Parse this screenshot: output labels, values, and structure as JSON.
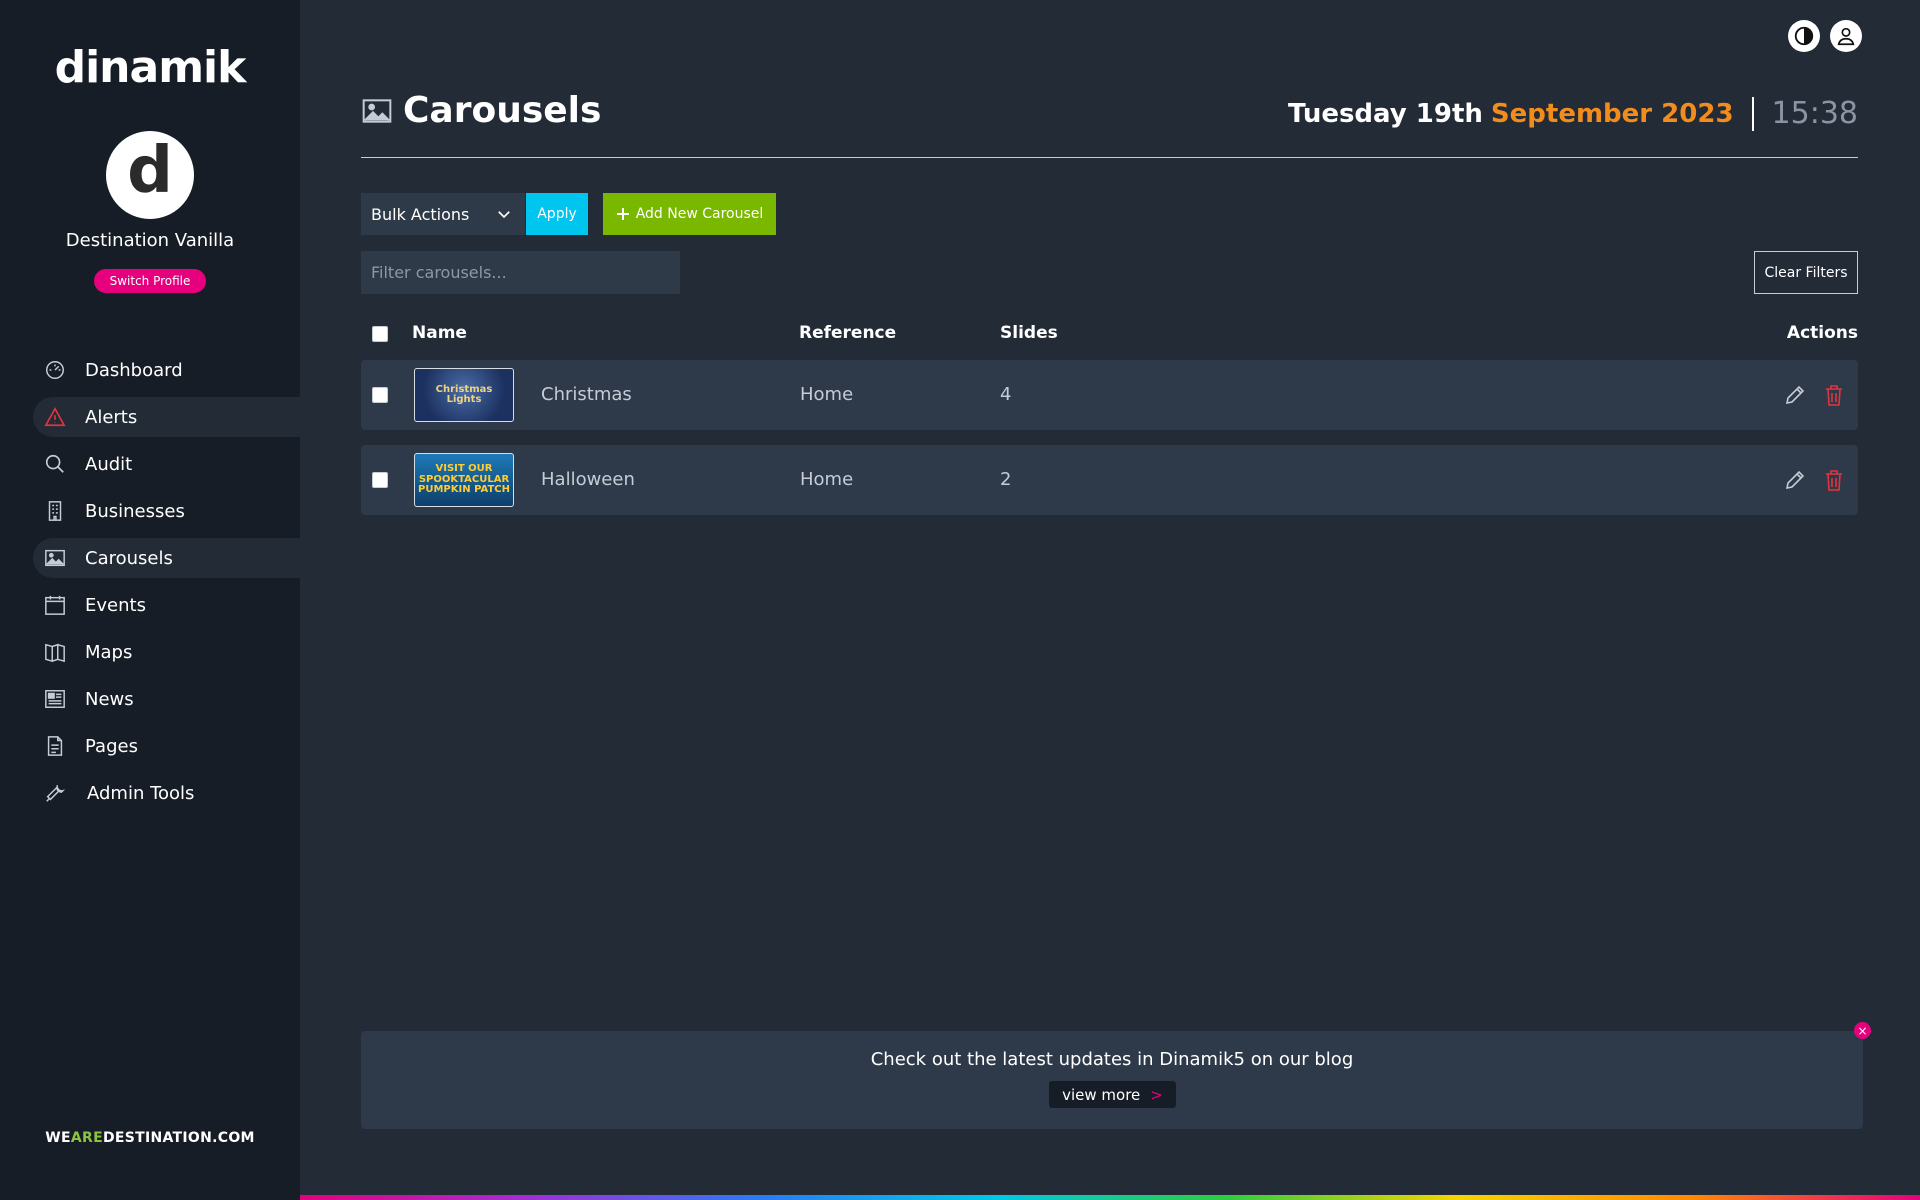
{
  "sidebar": {
    "logo": "dinamik",
    "avatar_letter": "d",
    "profile_name": "Destination Vanilla",
    "switch_profile": "Switch Profile",
    "items": [
      {
        "label": "Dashboard",
        "icon": "dashboard-gauge-icon"
      },
      {
        "label": "Alerts",
        "icon": "alert-triangle-icon"
      },
      {
        "label": "Audit",
        "icon": "search-icon"
      },
      {
        "label": "Businesses",
        "icon": "building-icon"
      },
      {
        "label": "Carousels",
        "icon": "image-icon"
      },
      {
        "label": "Events",
        "icon": "calendar-icon"
      },
      {
        "label": "Maps",
        "icon": "map-icon"
      },
      {
        "label": "News",
        "icon": "newspaper-icon"
      },
      {
        "label": "Pages",
        "icon": "document-icon"
      },
      {
        "label": "Admin Tools",
        "icon": "wrench-icon"
      }
    ],
    "footer": {
      "we": "WE",
      "are": "ARE",
      "destination": "DESTINATION.COM"
    }
  },
  "header": {
    "title": "Carousels",
    "date_day": "Tuesday 19th",
    "date_month": "September 2023",
    "time": "15:38"
  },
  "toolbar": {
    "bulk_actions": "Bulk Actions",
    "apply": "Apply",
    "add_new": "Add New Carousel",
    "filter_placeholder": "Filter carousels...",
    "clear_filters": "Clear Filters"
  },
  "table": {
    "columns": {
      "name": "Name",
      "reference": "Reference",
      "slides": "Slides",
      "actions": "Actions"
    },
    "rows": [
      {
        "name": "Christmas",
        "reference": "Home",
        "slides": "4",
        "thumb_text": "Christmas Lights"
      },
      {
        "name": "Halloween",
        "reference": "Home",
        "slides": "2",
        "thumb_text": "VISIT OUR SPOOKTACULAR PUMPKIN PATCH"
      }
    ]
  },
  "banner": {
    "text": "Check out the latest updates in Dinamik5 on our blog",
    "view_more": "view more",
    "arrow": ">",
    "close": "×"
  },
  "colors": {
    "accent_pink": "#e6007e",
    "accent_orange": "#f28c1d",
    "apply_cyan": "#00c5ef",
    "add_green": "#7ab800",
    "delete_red": "#e2343f"
  }
}
